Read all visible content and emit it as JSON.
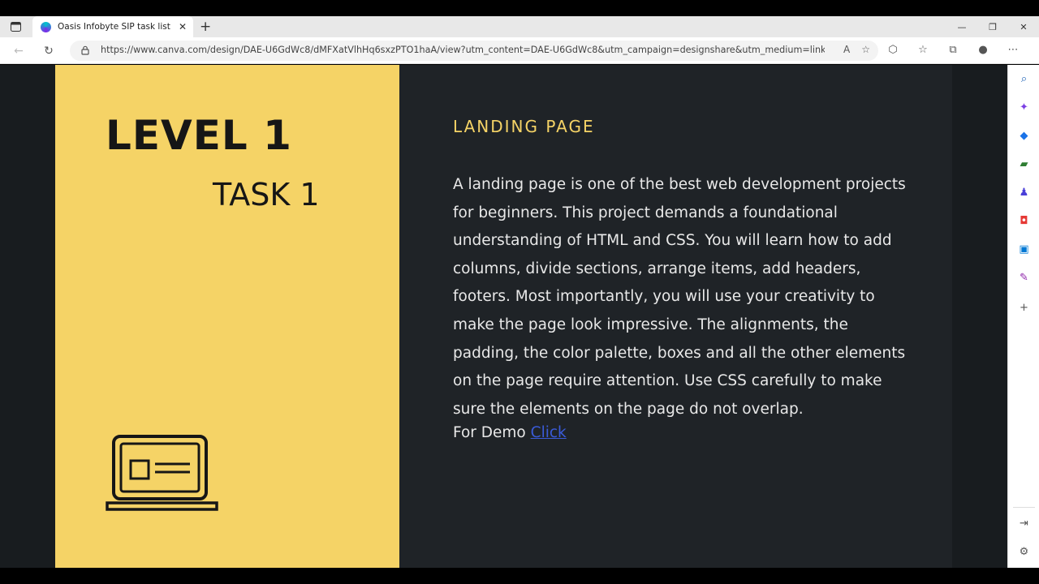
{
  "browser": {
    "tab_title": "Oasis Infobyte SIP task list",
    "url": "https://www.canva.com/design/DAE-U6GdWc8/dMFXatVlhHq6sxzPTO1haA/view?utm_content=DAE-U6GdWc8&utm_campaign=designshare&utm_medium=link2&utm_so..."
  },
  "slide": {
    "level": "LEVEL 1",
    "task": "TASK 1",
    "heading": "LANDING PAGE",
    "lines": [
      "A landing page is one of the best web development projects",
      "for beginners. This project demands a foundational",
      "understanding of HTML and CSS. You will learn how to add",
      "columns, divide sections, arrange items, add headers,",
      "footers. Most importantly, you will use your creativity to",
      "make the page look impressive. The alignments, the",
      "padding, the color palette, boxes and all the other elements",
      "on the page require attention. Use CSS carefully to make",
      "sure the elements on the page do not overlap."
    ],
    "demo_label": "For Demo",
    "demo_link": "Click "
  },
  "colors": {
    "accent_yellow": "#f5d366",
    "dark_panel": "#1f2327",
    "link_blue": "#3a5bd9"
  },
  "icons": [
    "search-icon",
    "sparkle-icon",
    "tag-icon",
    "toolbox-icon",
    "chess-icon",
    "office-icon",
    "outlook-icon",
    "designer-icon",
    "plus-icon"
  ]
}
